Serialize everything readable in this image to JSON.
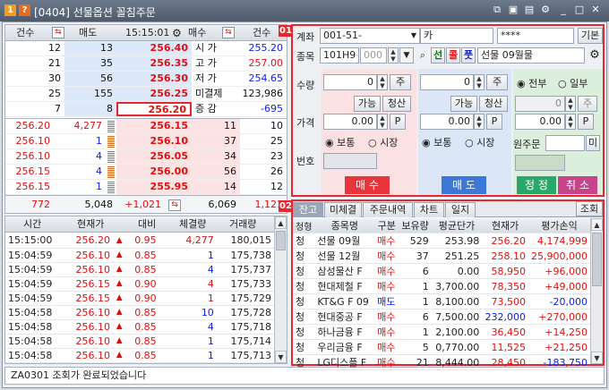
{
  "window": {
    "badge1": "1",
    "badge2": "?",
    "title": "[0404] 선물옵션 꼴침주문",
    "icons": [
      "window-link-icon",
      "copy-icon",
      "print-icon",
      "capture-icon",
      "settings-icon",
      "minimize-icon",
      "maximize-icon",
      "close-icon"
    ]
  },
  "orderbook": {
    "headers": {
      "count1": "건수",
      "ask_qty": "매도",
      "time": "15:15:01",
      "bid_qty": "매수",
      "count2": "건수"
    },
    "asks": [
      {
        "cnt": "12",
        "qty": "13",
        "price": "256.40"
      },
      {
        "cnt": "21",
        "qty": "35",
        "price": "256.35"
      },
      {
        "cnt": "30",
        "qty": "56",
        "price": "256.30"
      },
      {
        "cnt": "25",
        "qty": "155",
        "price": "256.25"
      },
      {
        "cnt": "7",
        "qty": "8",
        "price": "256.20"
      }
    ],
    "info": [
      {
        "label": "시 가",
        "value": "255.20",
        "color": "blue"
      },
      {
        "label": "고 가",
        "value": "257.00",
        "color": "red"
      },
      {
        "label": "저 가",
        "value": "254.65",
        "color": "blue"
      },
      {
        "label": "미결제",
        "value": "123,986",
        "color": "dark"
      },
      {
        "label": "증 감",
        "value": "-695",
        "color": "blue"
      }
    ],
    "bids": [
      {
        "fill": "256.20",
        "fqty": "4,277",
        "price": "256.15",
        "qty": "11",
        "cnt": "10"
      },
      {
        "fill": "256.10",
        "fqty": "1",
        "price": "256.10",
        "qty": "37",
        "cnt": "25"
      },
      {
        "fill": "256.10",
        "fqty": "4",
        "price": "256.05",
        "qty": "34",
        "cnt": "23"
      },
      {
        "fill": "256.15",
        "fqty": "4",
        "price": "256.00",
        "qty": "56",
        "cnt": "26"
      },
      {
        "fill": "256.15",
        "fqty": "1",
        "price": "255.95",
        "qty": "14",
        "cnt": "12"
      }
    ],
    "totals": {
      "ask_cnt": "772",
      "ask_qty": "5,048",
      "diff": "+1,021",
      "bid_qty": "6,069",
      "bid_cnt": "1,121"
    }
  },
  "ticks": {
    "headers": [
      "시간",
      "현재가",
      "대비",
      "체결량",
      "거래량"
    ],
    "rows": [
      [
        "15:15:00",
        "256.20",
        "▲",
        "0.95",
        "4,277",
        "180,015"
      ],
      [
        "15:04:59",
        "256.10",
        "▲",
        "0.85",
        "1",
        "175,738"
      ],
      [
        "15:04:59",
        "256.10",
        "▲",
        "0.85",
        "4",
        "175,737"
      ],
      [
        "15:04:59",
        "256.15",
        "▲",
        "0.90",
        "4",
        "175,733"
      ],
      [
        "15:04:59",
        "256.15",
        "▲",
        "0.90",
        "1",
        "175,729"
      ],
      [
        "15:04:58",
        "256.10",
        "▲",
        "0.85",
        "10",
        "175,728"
      ],
      [
        "15:04:58",
        "256.10",
        "▲",
        "0.85",
        "4",
        "175,718"
      ],
      [
        "15:04:58",
        "256.10",
        "▲",
        "0.85",
        "1",
        "175,714"
      ],
      [
        "15:04:58",
        "256.10",
        "▲",
        "0.85",
        "1",
        "175,713"
      ]
    ]
  },
  "status": {
    "text": "ZA0301 조회가 완료되었습니다"
  },
  "order": {
    "section_no": "01",
    "account_label": "계좌",
    "account_value": "001-51-",
    "account_name": "카",
    "password": "****",
    "basic_btn": "기본",
    "code_label": "종목",
    "code_value": "101H9",
    "code_sub": "000",
    "sun_btn": "선",
    "call_btn": "콜",
    "put_btn": "풋",
    "instrument_name": "선물 09월물",
    "qty_label": "수량",
    "price_label": "가격",
    "no_label": "번호",
    "buy": {
      "qty": "0",
      "unit": "주",
      "avail": "가능",
      "clear": "청산",
      "price": "0.00",
      "p": "P",
      "normal": "보통",
      "market": "시장",
      "submit": "매 수"
    },
    "sell": {
      "qty": "0",
      "unit": "주",
      "avail": "가능",
      "clear": "청산",
      "price": "0.00",
      "p": "P",
      "normal": "보통",
      "market": "시장",
      "submit": "매 도"
    },
    "modify": {
      "all": "전부",
      "part": "일부",
      "qty": "0",
      "unit": "주",
      "price": "0.00",
      "p": "P",
      "orig_label": "원주문",
      "mi": "미",
      "correct": "정 정",
      "cancel": "취 소"
    }
  },
  "positions": {
    "section_no": "02",
    "tabs": [
      "잔고",
      "미체결",
      "주문내역",
      "차트",
      "일지"
    ],
    "inquiry_btn": "조회",
    "headers": [
      "청형",
      "종목명",
      "구분",
      "보유량",
      "평균단가",
      "현재가",
      "평가손익"
    ],
    "rows": [
      [
        "청",
        "선물 09월",
        "매수",
        "529",
        "253.98",
        "256.20",
        "4,174,999"
      ],
      [
        "청",
        "선물 12월",
        "매수",
        "37",
        "251.25",
        "258.10",
        "25,900,000"
      ],
      [
        "청",
        "삼성물산 F",
        "매수",
        "6",
        "0.00",
        "58,950",
        "+96,000"
      ],
      [
        "청",
        "현대제철 F",
        "매수",
        "1",
        "3,700.00",
        "78,350",
        "+49,000"
      ],
      [
        "청",
        "KT&G F 09",
        "매도",
        "1",
        "8,100.00",
        "73,500",
        "-20,000"
      ],
      [
        "청",
        "현대중공 F",
        "매수",
        "6",
        "7,500.00",
        "232,000",
        "+270,000"
      ],
      [
        "청",
        "하나금융 F",
        "매수",
        "1",
        "2,100.00",
        "36,450",
        "+14,250"
      ],
      [
        "청",
        "우리금융 F",
        "매수",
        "5",
        "0,770.00",
        "11,525",
        "+21,250"
      ],
      [
        "청",
        "LG디스플 F",
        "매수",
        "21",
        "8,444.00",
        "28,450",
        "-183,750"
      ]
    ],
    "row_colors": [
      [
        "red",
        "red"
      ],
      [
        "red",
        "red"
      ],
      [
        "red",
        "red"
      ],
      [
        "red",
        "red"
      ],
      [
        "blue",
        "blue"
      ],
      [
        "blue",
        "red"
      ],
      [
        "red",
        "red"
      ],
      [
        "red",
        "red"
      ],
      [
        "red",
        "blue"
      ]
    ]
  }
}
